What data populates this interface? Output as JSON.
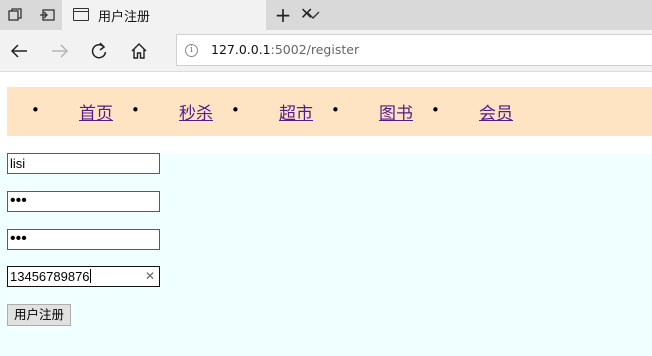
{
  "browser": {
    "tab_title": "用户注册",
    "url_host": "127.0.0.1",
    "url_path": ":5002/register"
  },
  "nav": {
    "items": [
      {
        "label": "首页"
      },
      {
        "label": "秒杀"
      },
      {
        "label": "超市"
      },
      {
        "label": "图书"
      },
      {
        "label": "会员"
      }
    ]
  },
  "form": {
    "username_value": "lisi",
    "password_value": "•••",
    "confirm_password_value": "•••",
    "phone_value": "13456789876",
    "submit_label": "用户注册"
  },
  "colors": {
    "nav_background": "#ffe4c4",
    "form_background": "#f0ffff",
    "link": "#551a8b"
  }
}
